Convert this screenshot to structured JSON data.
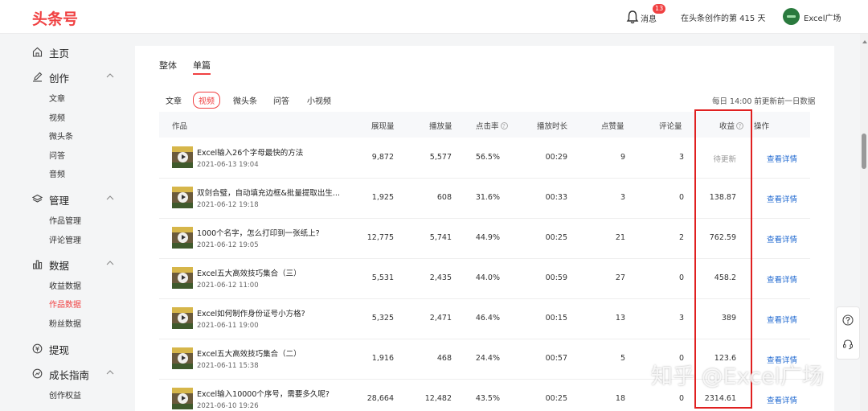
{
  "header": {
    "logo": "头条号",
    "notifications_label": "消息",
    "notifications_count": "13",
    "days_text": "在头条创作的第 415 天",
    "username": "Excel广场"
  },
  "sidebar": {
    "groups": [
      {
        "label": "主页",
        "icon": "home-icon"
      },
      {
        "label": "创作",
        "icon": "edit-icon",
        "items": [
          "文章",
          "视频",
          "微头条",
          "问答",
          "音频"
        ]
      },
      {
        "label": "管理",
        "icon": "layers-icon",
        "items": [
          "作品管理",
          "评论管理"
        ]
      },
      {
        "label": "数据",
        "icon": "bar-chart-icon",
        "items": [
          "收益数据",
          "作品数据",
          "粉丝数据"
        ],
        "active": "作品数据"
      },
      {
        "label": "提现",
        "icon": "coin-icon"
      },
      {
        "label": "成长指南",
        "icon": "growth-icon",
        "items": [
          "创作权益"
        ]
      }
    ]
  },
  "main": {
    "tabs": [
      "整体",
      "单篇"
    ],
    "active_tab": "单篇",
    "subtabs": [
      "文章",
      "视频",
      "微头条",
      "问答",
      "小视频"
    ],
    "active_subtab": "视频",
    "update_note": "每日 14:00 前更新前一日数据",
    "columns": [
      "作品",
      "展现量",
      "播放量",
      "点击率",
      "播放时长",
      "点赞量",
      "评论量",
      "收益",
      "操作"
    ],
    "detail_label": "查看详情",
    "rows": [
      {
        "title": "Excel输入26个字母最快的方法",
        "date": "2021-06-13 19:04",
        "impressions": "9,872",
        "plays": "5,577",
        "ctr": "56.5%",
        "duration": "00:29",
        "likes": "9",
        "comments": "3",
        "income": "待更新"
      },
      {
        "title": "双剑合璧，自动填充边框&批量提取出生...",
        "date": "2021-06-12 19:18",
        "impressions": "1,925",
        "plays": "608",
        "ctr": "31.6%",
        "duration": "00:33",
        "likes": "3",
        "comments": "0",
        "income": "138.87"
      },
      {
        "title": "1000个名字，怎么打印到一张纸上?",
        "date": "2021-06-12 19:05",
        "impressions": "12,775",
        "plays": "5,741",
        "ctr": "44.9%",
        "duration": "00:25",
        "likes": "21",
        "comments": "2",
        "income": "762.59"
      },
      {
        "title": "Excel五大高效技巧集合（三）",
        "date": "2021-06-12 11:00",
        "impressions": "5,531",
        "plays": "2,435",
        "ctr": "44.0%",
        "duration": "00:59",
        "likes": "27",
        "comments": "0",
        "income": "458.2"
      },
      {
        "title": "Excel如何制作身份证号小方格?",
        "date": "2021-06-11 19:00",
        "impressions": "5,325",
        "plays": "2,471",
        "ctr": "46.4%",
        "duration": "00:15",
        "likes": "13",
        "comments": "3",
        "income": "389"
      },
      {
        "title": "Excel五大高效技巧集合（二）",
        "date": "2021-06-11 15:38",
        "impressions": "1,916",
        "plays": "468",
        "ctr": "24.4%",
        "duration": "00:57",
        "likes": "5",
        "comments": "0",
        "income": "123.6"
      },
      {
        "title": "Excel输入10000个序号，需要多久呢?",
        "date": "2021-06-10 19:26",
        "impressions": "28,664",
        "plays": "12,482",
        "ctr": "43.5%",
        "duration": "00:25",
        "likes": "18",
        "comments": "0",
        "income": "2314.61"
      }
    ]
  },
  "watermark": "知乎 @Excel广场",
  "colors": {
    "brand": "#f04142",
    "link": "#1f68d0",
    "highlight": "#e02020"
  }
}
